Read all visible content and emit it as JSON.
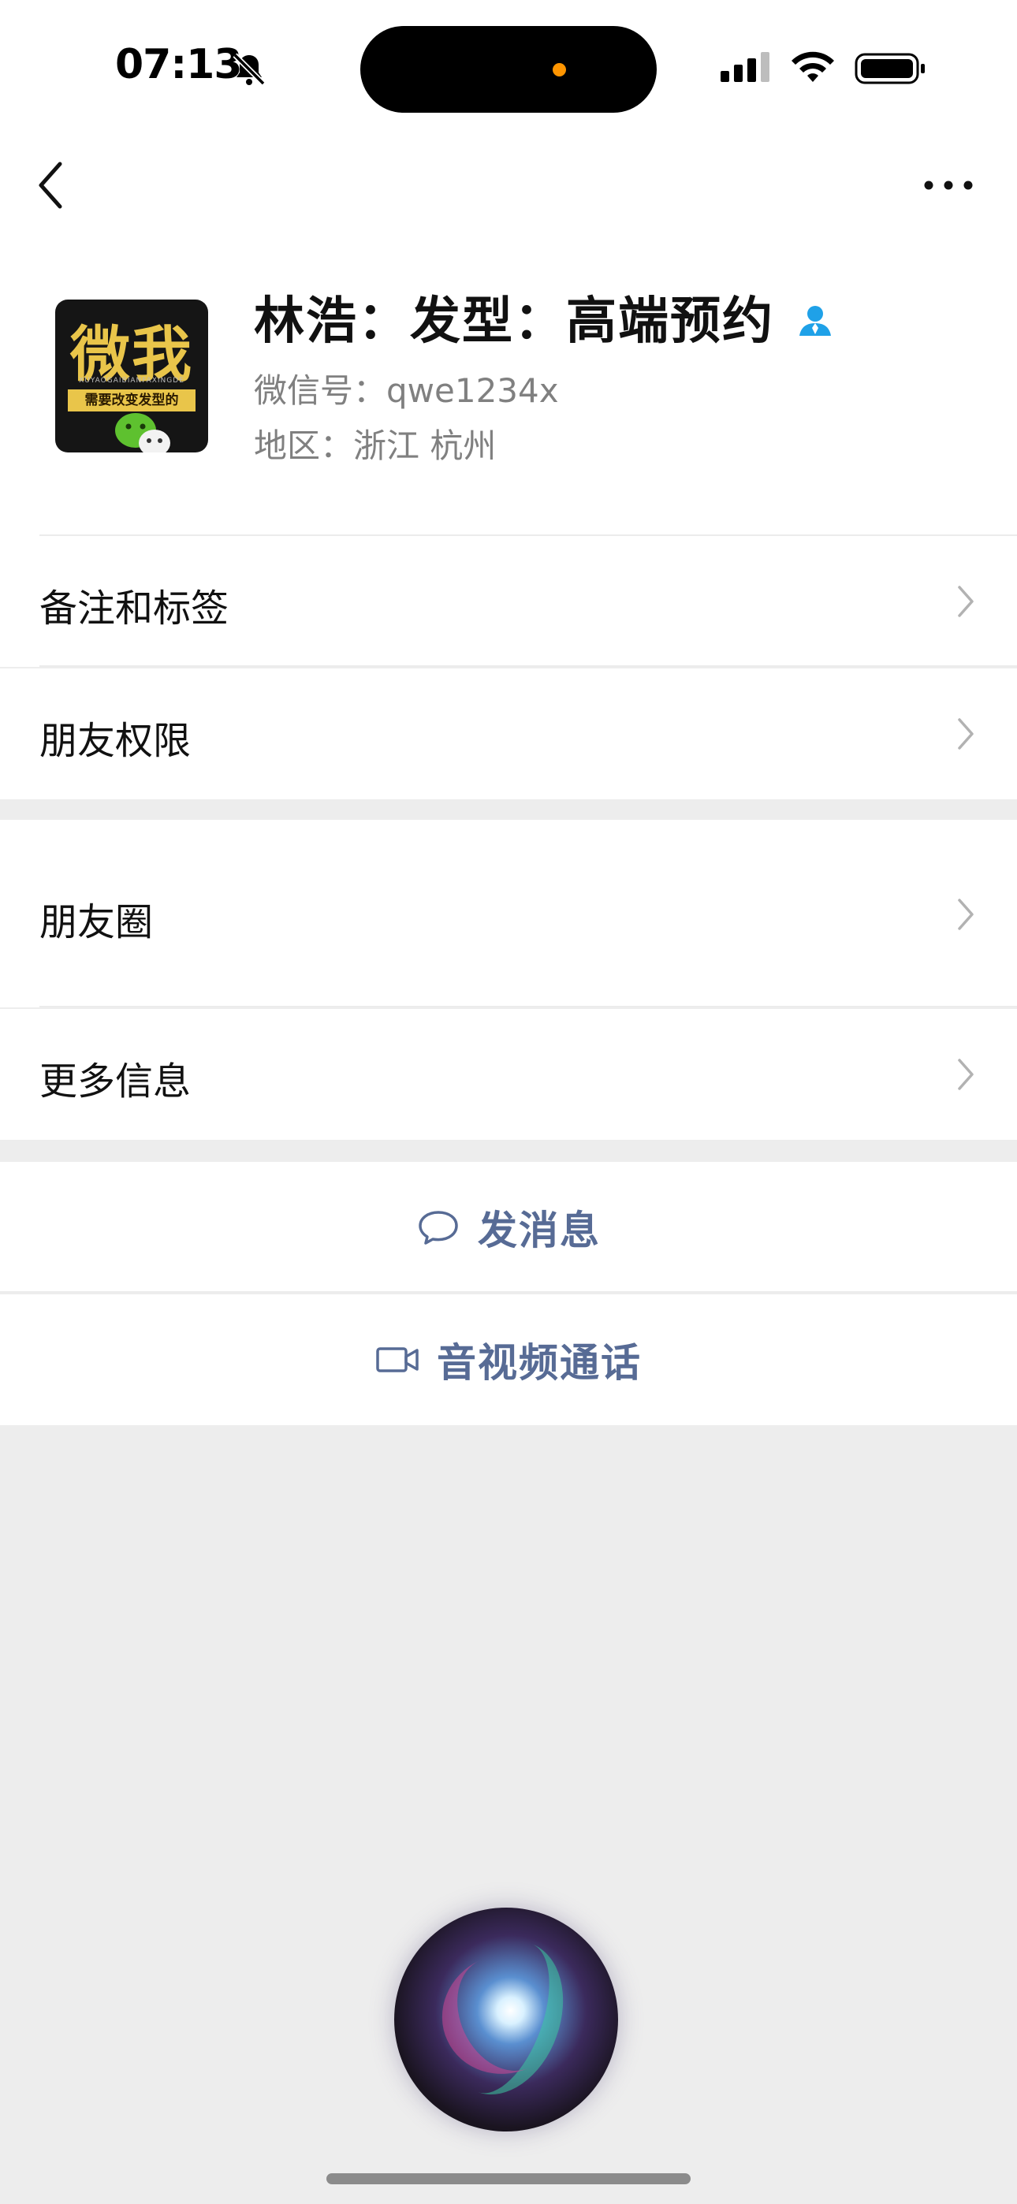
{
  "status_bar": {
    "time": "07:13",
    "icons": [
      "bell-slash-icon",
      "cellular-signal-icon",
      "wifi-icon",
      "battery-icon"
    ]
  },
  "nav": {
    "back_icon": "chevron-left-icon",
    "more_icon": "ellipsis-icon"
  },
  "profile": {
    "name": "林浩：发型：高端预约",
    "wechat_id": "微信号：qwe1234x",
    "region": "地区：浙江 杭州",
    "avatar": {
      "title": "微我",
      "subtitle": "XUYAOGAIBIANFAXINGDE",
      "banner": "需要改变发型的"
    }
  },
  "menu": {
    "remarks_tags": "备注和标签",
    "friend_permissions": "朋友权限",
    "moments": "朋友圈",
    "more_info": "更多信息"
  },
  "actions": {
    "send_message": "发消息",
    "av_call": "音视频通话"
  },
  "colors": {
    "link_blue": "#576b95",
    "background": "#ededed",
    "verified_blue": "#1fa1e8"
  }
}
